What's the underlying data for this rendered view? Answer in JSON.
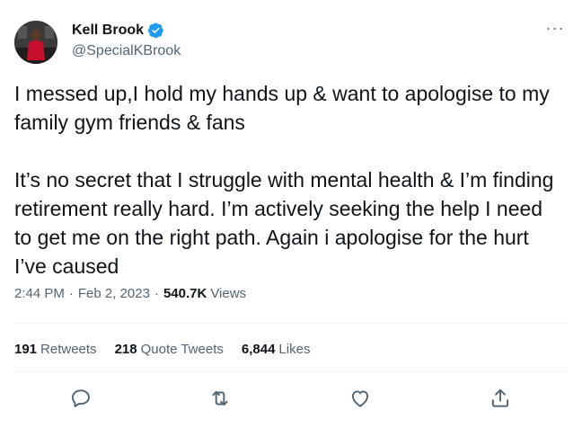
{
  "author": {
    "display_name": "Kell Brook",
    "handle": "@SpecialKBrook",
    "verified": true
  },
  "tweet": {
    "paragraphs": [
      "I messed up,I hold my hands up & want to apologise to my family gym friends & fans",
      "It’s no secret that I struggle with mental health & I’m finding retirement really hard. I’m actively seeking the help I need to get me on the right path. Again i apologise for the hurt I’ve caused"
    ],
    "time": "2:44 PM",
    "separator": "·",
    "date": "Feb 2, 2023",
    "views_count": "540.7K",
    "views_label": "Views"
  },
  "stats": {
    "retweets_count": "191",
    "retweets_label": "Retweets",
    "quotes_count": "218",
    "quotes_label": "Quote Tweets",
    "likes_count": "6,844",
    "likes_label": "Likes"
  },
  "icons": {
    "verified": "verified-badge-icon",
    "more": "more-icon",
    "reply": "reply-icon",
    "retweet": "retweet-icon",
    "like": "like-icon",
    "share": "share-icon"
  },
  "colors": {
    "text": "#0f1419",
    "secondary": "#536471",
    "verified": "#1d9bf0",
    "divider": "#eff3f4"
  }
}
